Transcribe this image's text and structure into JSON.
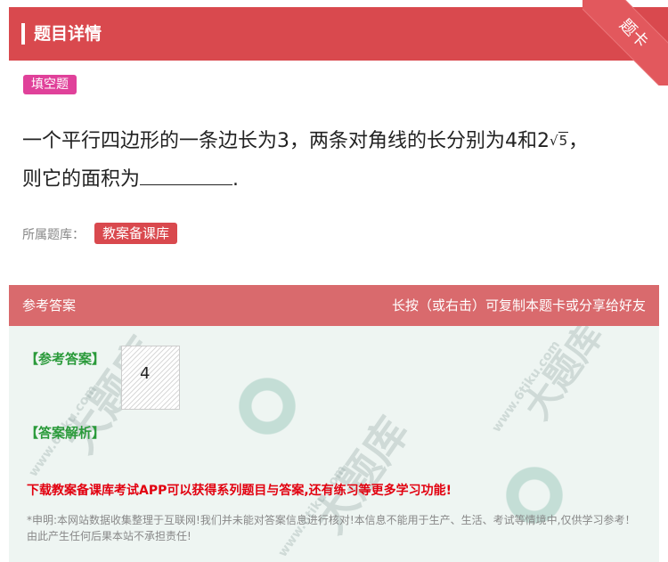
{
  "header": {
    "title": "题目详情",
    "corner_label": "题卡"
  },
  "question": {
    "type_tag": "填空题",
    "text_part1": "一个平行四边形的一条边长为3，两条对角线的长分别为4和2",
    "sqrt_symbol": "√",
    "sqrt_radicand": "5",
    "text_part2": "，",
    "text_line2_prefix": "则它的面积为",
    "text_line2_suffix": ".",
    "bank_label": "所属题库：",
    "bank_name": "教案备课库"
  },
  "answer": {
    "header_left": "参考答案",
    "header_right": "长按（或右击）可复制本题卡或分享给好友",
    "ref_answer_title": "【参考答案】",
    "answer_image_value": "4",
    "analysis_title": "【答案解析】",
    "promo_text": "下载教案备课库考试APP可以获得系列题目与答案,还有练习等更多学习功能!",
    "disclaimer": "*申明:本网站数据收集整理于互联网!我们并未能对答案信息进行核对!本信息不能用于生产、生活、考试等情境中,仅供学习参考！由此产生任何后果本站不承担责任!"
  },
  "watermark": {
    "brand": "大题库",
    "url": "www.6tiku.com"
  }
}
